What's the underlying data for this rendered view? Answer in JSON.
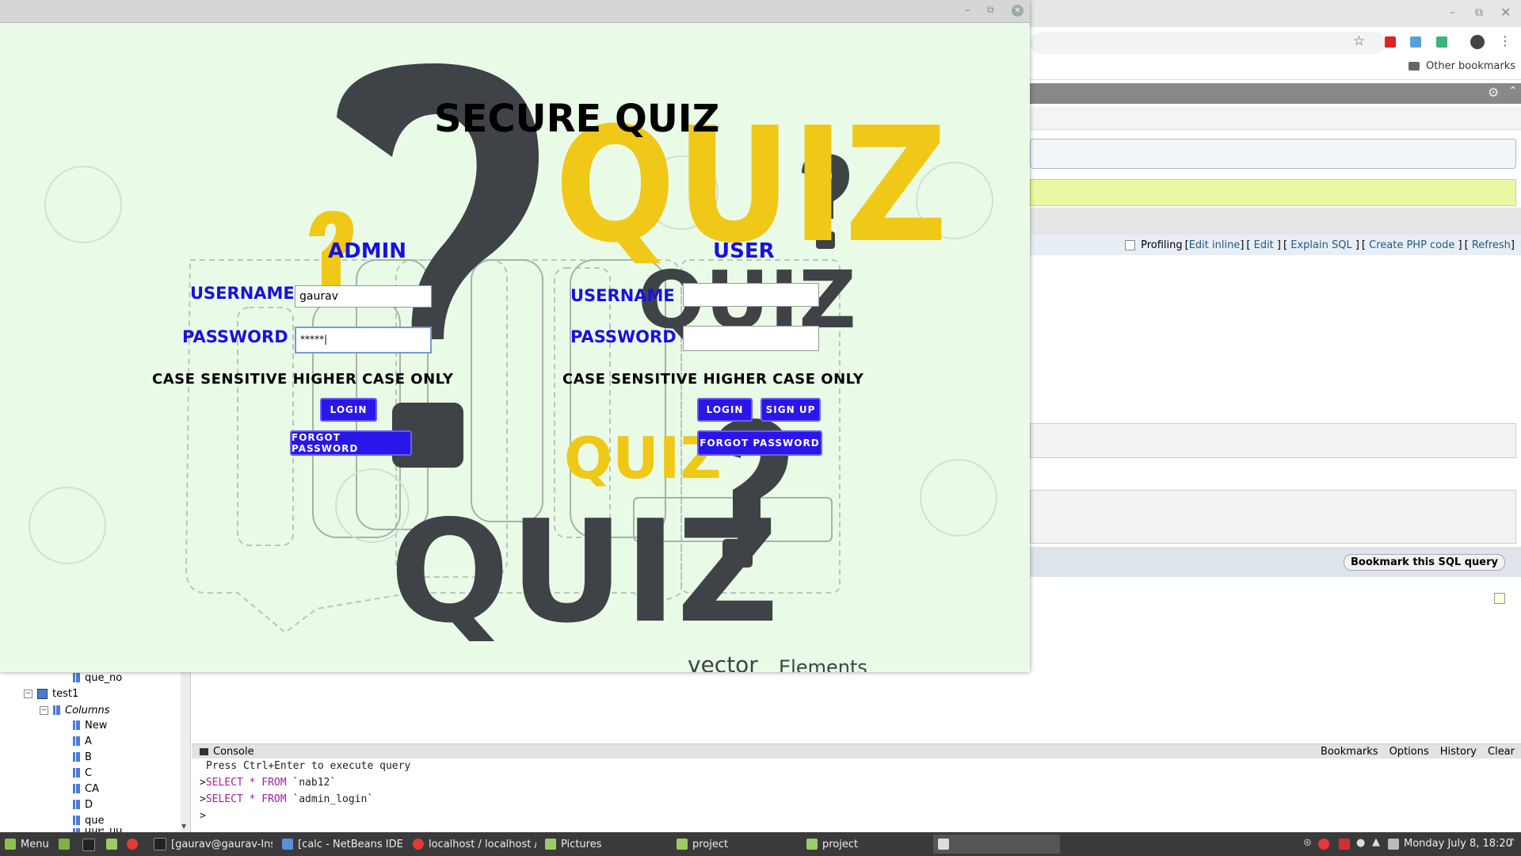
{
  "browser": {
    "bookmarks": {
      "other": "Other bookmarks"
    },
    "profiling": {
      "checkbox_label": "Profiling",
      "links": [
        "Edit inline",
        "Edit",
        "Explain SQL",
        "Create PHP code",
        "Refresh"
      ]
    },
    "bookmark_button": "Bookmark this SQL query"
  },
  "quiz": {
    "title": "SECURE QUIZ",
    "bg_words": {
      "quiz_big_yellow": "QUIZ",
      "quiz_small_yellow": "QUIZ",
      "quiz_bottom": "QUIZ",
      "quiz_middle": "QUIZ",
      "vector": "vector",
      "elements": "Elements"
    },
    "admin": {
      "heading": "ADMIN",
      "username_label": "USERNAME",
      "username_value": "gaurav",
      "password_label": "PASSWORD",
      "password_value": "*****|",
      "note": "CASE SENSITIVE HIGHER CASE ONLY",
      "login": "LOGIN",
      "forgot": "FORGOT PASSWORD"
    },
    "user": {
      "heading": "USER",
      "username_label": "USERNAME",
      "username_value": "",
      "password_label": "PASSWORD",
      "password_value": "",
      "note": "CASE SENSITIVE HIGHER CASE ONLY",
      "login": "LOGIN",
      "signup": "SIGN UP",
      "forgot": "FORGOT PASSWORD"
    }
  },
  "netbeans": {
    "tree": {
      "items": [
        "que_no",
        "test1",
        "Columns",
        "New",
        "A",
        "B",
        "C",
        "CA",
        "D",
        "que",
        "que_no"
      ]
    },
    "console": {
      "title": "Console",
      "actions": [
        "Bookmarks",
        "Options",
        "History",
        "Clear"
      ],
      "hint": "Press Ctrl+Enter to execute query",
      "lines": [
        {
          "prompt": ">",
          "keyword": "SELECT * FROM",
          "rest": " `nab12`"
        },
        {
          "prompt": ">",
          "keyword": "SELECT * FROM",
          "rest": " `admin_login`"
        }
      ],
      "cursor": ">"
    }
  },
  "taskbar": {
    "menu": "Menu",
    "tasks": [
      "[gaurav@gaurav-Ins...",
      "[calc - NetBeans IDE ...",
      "localhost / localhost / ...",
      "Pictures",
      "project",
      "project"
    ],
    "clock": "Monday July 8, 18:20"
  },
  "colors": {
    "accent_blue": "#2a16e8",
    "label_blue": "#1a10e0",
    "quiz_yellow": "#f0c818",
    "quiz_gray": "#3f4246",
    "bg_green": "#e9fbe7"
  }
}
